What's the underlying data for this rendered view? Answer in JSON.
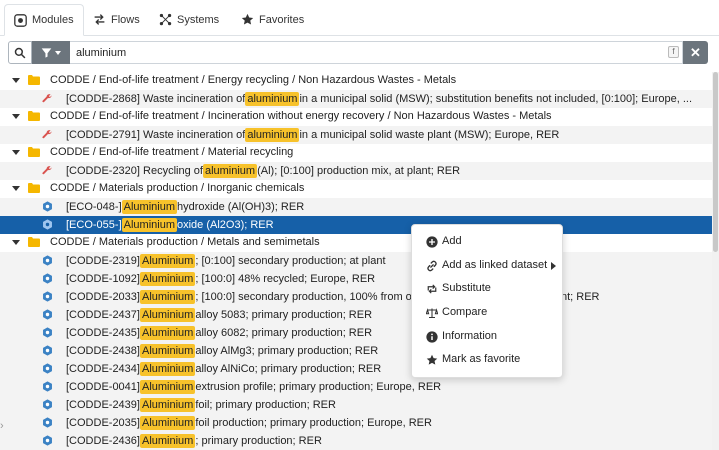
{
  "tabs": [
    {
      "label": "Modules",
      "icon": "modules-icon"
    },
    {
      "label": "Flows",
      "icon": "flows-icon"
    },
    {
      "label": "Systems",
      "icon": "systems-icon"
    },
    {
      "label": "Favorites",
      "icon": "star-icon"
    }
  ],
  "search": {
    "value": "aluminium",
    "fx_badge": "f"
  },
  "tree": {
    "folders": [
      {
        "label": "CODDE / End-of-life treatment / Energy recycling / Non Hazardous Wastes - Metals"
      },
      {
        "label": "CODDE / End-of-life treatment / Incineration without energy recovery / Non Hazardous Wastes - Metals"
      },
      {
        "label": "CODDE / End-of-life treatment / Material recycling"
      },
      {
        "label": "CODDE / Materials production / Inorganic chemicals"
      },
      {
        "label": "CODDE / Materials production / Metals and semimetals"
      }
    ],
    "leaves": [
      {
        "pre": "[CODDE-2868] Waste incineration of ",
        "hl": "aluminium",
        "post": " in a municipal solid (MSW); substitution benefits not included, [0:100]; Europe, ...",
        "icon": "wrench-icon"
      },
      {
        "pre": "[CODDE-2791] Waste incineration of ",
        "hl": "aluminium",
        "post": " in a municipal solid waste plant (MSW); Europe, RER",
        "icon": "wrench-icon"
      },
      {
        "pre": "[CODDE-2320] Recycling of ",
        "hl": "aluminium",
        "post": " (Al); [0:100] production mix, at plant; RER",
        "icon": "wrench-icon"
      },
      {
        "pre": "[ECO-048-] ",
        "hl": "Aluminium",
        "post": " hydroxide (Al(OH)3); RER",
        "icon": "process-icon"
      },
      {
        "pre": "[ECO-055-] ",
        "hl": "Aluminium",
        "post": " oxide (Al2O3); RER",
        "icon": "process-icon"
      },
      {
        "pre": "[CODDE-2319] ",
        "hl": "Aluminium",
        "post": "; [0:100] secondary production; at plant",
        "icon": "process-icon"
      },
      {
        "pre": "[CODDE-1092] ",
        "hl": "Aluminium",
        "post": "; [100:0] 48% recycled; Europe, RER",
        "icon": "process-icon"
      },
      {
        "pre": "[CODDE-2033] ",
        "hl": "Aluminium",
        "post": "; [100:0] secondary production, 100% from old scrap, production mix, at plant; RER",
        "icon": "process-icon"
      },
      {
        "pre": "[CODDE-2437] ",
        "hl": "Aluminium",
        "post": " alloy 5083; primary production; RER",
        "icon": "process-icon"
      },
      {
        "pre": "[CODDE-2435] ",
        "hl": "Aluminium",
        "post": " alloy 6082; primary production; RER",
        "icon": "process-icon"
      },
      {
        "pre": "[CODDE-2438] ",
        "hl": "Aluminium",
        "post": " alloy AlMg3; primary production; RER",
        "icon": "process-icon"
      },
      {
        "pre": "[CODDE-2434] ",
        "hl": "Aluminium",
        "post": " alloy AlNiCo; primary production; RER",
        "icon": "process-icon"
      },
      {
        "pre": "[CODDE-0041] ",
        "hl": "Aluminium",
        "post": " extrusion profile; primary production; Europe, RER",
        "icon": "process-icon"
      },
      {
        "pre": "[CODDE-2439] ",
        "hl": "Aluminium",
        "post": " foil; primary production; RER",
        "icon": "process-icon"
      },
      {
        "pre": "[CODDE-2035] ",
        "hl": "Aluminium",
        "post": " foil production; primary production; Europe, RER",
        "icon": "process-icon"
      },
      {
        "pre": "[CODDE-2436] ",
        "hl": "Aluminium",
        "post": "; primary production; RER",
        "icon": "process-icon"
      }
    ]
  },
  "context_menu": [
    {
      "label": "Add",
      "icon": "plus-circle-icon"
    },
    {
      "label": "Add as linked dataset",
      "icon": "link-icon"
    },
    {
      "label": "Substitute",
      "icon": "substitute-icon"
    },
    {
      "label": "Compare",
      "icon": "balance-icon"
    },
    {
      "label": "Information",
      "icon": "info-icon"
    },
    {
      "label": "Mark as favorite",
      "icon": "star-icon"
    }
  ],
  "colors": {
    "highlight": "#f7c22b",
    "selected": "#1660a8",
    "folder": "#f5b700",
    "wrench": "#d9534f",
    "process": "#3b82c4"
  }
}
